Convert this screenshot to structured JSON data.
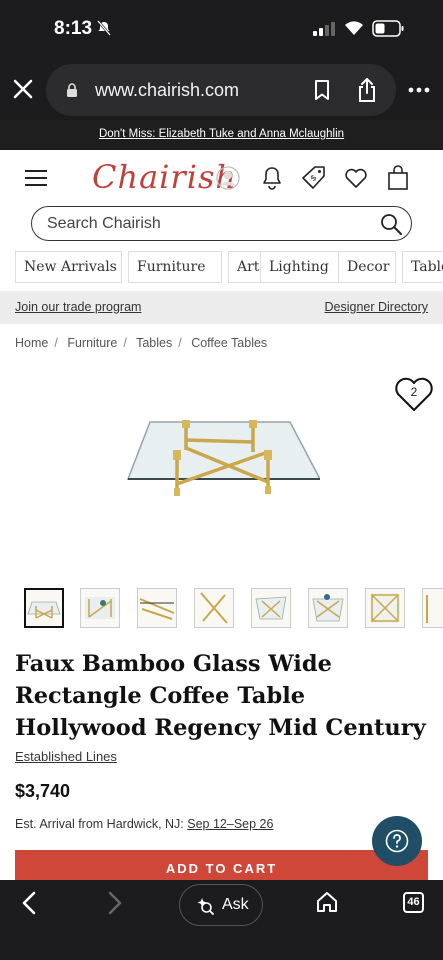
{
  "status": {
    "time": "8:13"
  },
  "browser": {
    "url": "www.chairish.com"
  },
  "promo": {
    "text": "Don't Miss: Elizabeth Tuke and Anna Mclaughlin"
  },
  "header": {
    "logo": "Chairish"
  },
  "search": {
    "placeholder": "Search Chairish"
  },
  "categories": [
    "New Arrivals",
    "Furniture",
    "Art",
    "Lighting",
    "Decor",
    "Table"
  ],
  "trade": {
    "join": "Join our trade program",
    "directory": "Designer Directory"
  },
  "breadcrumb": [
    "Home",
    "Furniture",
    "Tables",
    "Coffee Tables"
  ],
  "favorite": {
    "count": "2"
  },
  "product": {
    "title": "Faux Bamboo Glass Wide Rectangle Coffee Table Hollywood Regency Mid Century",
    "seller": "Established Lines",
    "price": "$3,740",
    "arrival_prefix": "Est. Arrival from Hardwick, NJ:",
    "arrival_dates": "Sep 12–Sep 26",
    "add_to_cart": "ADD TO CART"
  },
  "toolbar": {
    "ask": "Ask",
    "tab_count": "46"
  },
  "colors": {
    "brand": "#c0403a",
    "cart": "#cf4738",
    "help": "#1f4e66"
  }
}
